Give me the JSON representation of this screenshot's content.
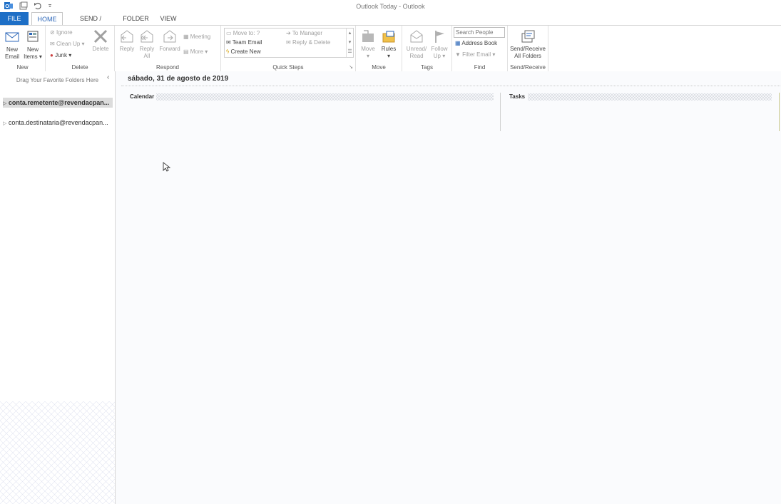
{
  "window": {
    "title": "Outlook Today - Outlook"
  },
  "tabs": [
    "FILE",
    "HOME",
    "SEND / RECEIVE",
    "FOLDER",
    "VIEW"
  ],
  "ribbon": {
    "new": {
      "label": "New",
      "new_email": [
        "New",
        "Email"
      ],
      "new_items": [
        "New",
        "Items"
      ]
    },
    "delete": {
      "label": "Delete",
      "ignore": "Ignore",
      "cleanup": "Clean Up",
      "junk": "Junk",
      "delete": "Delete"
    },
    "respond": {
      "label": "Respond",
      "reply": "Reply",
      "reply_all": [
        "Reply",
        "All"
      ],
      "forward": "Forward",
      "meeting": "Meeting",
      "more": "More"
    },
    "quicksteps": {
      "label": "Quick Steps",
      "items": [
        "Move to: ?",
        "Team Email",
        "Create New",
        "To Manager",
        "Reply & Delete"
      ]
    },
    "move": {
      "label": "Move",
      "move": "Move",
      "rules": "Rules"
    },
    "tags": {
      "label": "Tags",
      "unread": [
        "Unread/",
        "Read"
      ],
      "follow": [
        "Follow",
        "Up"
      ]
    },
    "find": {
      "label": "Find",
      "search_placeholder": "Search People",
      "address_book": "Address Book",
      "filter_email": "Filter Email"
    },
    "sendreceive": {
      "label": "Send/Receive",
      "btn": [
        "Send/Receive",
        "All Folders"
      ]
    }
  },
  "leftpane": {
    "drag_text": "Drag Your Favorite Folders Here",
    "accounts": [
      "conta.remetente@revendacpan...",
      "conta.destinataria@revendacpan..."
    ]
  },
  "main": {
    "date": "sábado, 31 de agosto de 2019",
    "calendar_label": "Calendar",
    "tasks_label": "Tasks"
  },
  "colors": {
    "file_tab": "#1e6fc6",
    "accent": "#2b66b8"
  }
}
